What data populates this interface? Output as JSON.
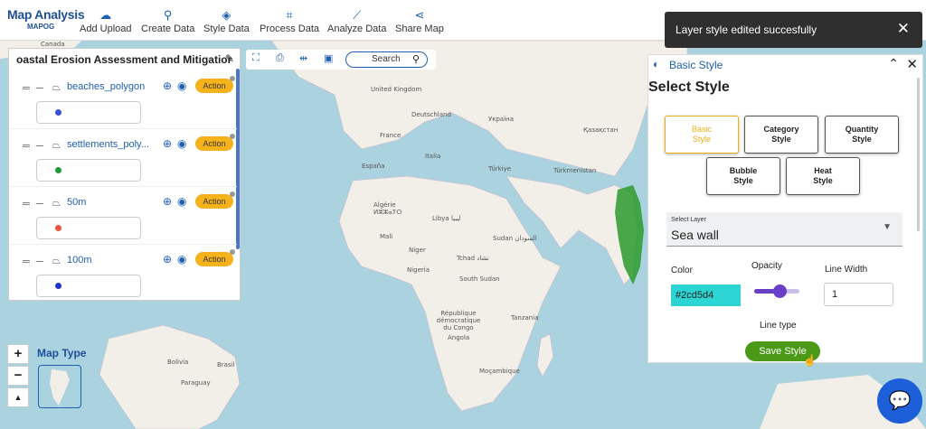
{
  "app": {
    "logo_line1": "Map Analysis",
    "logo_line2": "MAPOG"
  },
  "toolbar": [
    {
      "label": "Add Upload",
      "icon": "cloud-upload-icon",
      "glyph": "☁"
    },
    {
      "label": "Create Data",
      "icon": "map-pin-icon",
      "glyph": "⚲"
    },
    {
      "label": "Style Data",
      "icon": "paint-bucket-icon",
      "glyph": "◈"
    },
    {
      "label": "Process Data",
      "icon": "process-nodes-icon",
      "glyph": "⌗"
    },
    {
      "label": "Analyze Data",
      "icon": "analyze-icon",
      "glyph": "⟋"
    },
    {
      "label": "Share Map",
      "icon": "share-icon",
      "glyph": "⋖"
    }
  ],
  "layer_panel": {
    "title": "oastal Erosion Assessment and Mitigation",
    "action_label": "Action",
    "layers": [
      {
        "name": "beaches_polygon",
        "color": "#3a4fd8"
      },
      {
        "name": "settlements_poly...",
        "color": "#1e9a3a"
      },
      {
        "name": "50m",
        "color": "#e8553a"
      },
      {
        "name": "100m",
        "color": "#2233cc"
      }
    ]
  },
  "map_tools": {
    "search_label": "Search"
  },
  "toast": {
    "message": "Layer style edited succesfully"
  },
  "style_panel": {
    "header": "Basic Style",
    "title": "Select Style",
    "buttons": [
      {
        "line1": "Basic",
        "line2": "Style",
        "active": true
      },
      {
        "line1": "Category",
        "line2": "Style",
        "active": false
      },
      {
        "line1": "Quantity",
        "line2": "Style",
        "active": false
      },
      {
        "line1": "Bubble",
        "line2": "Style",
        "active": false
      },
      {
        "line1": "Heat",
        "line2": "Style",
        "active": false
      }
    ],
    "select_layer_label": "Select Layer",
    "select_layer_value": "Sea wall",
    "color_label": "Color",
    "color_value": "#2cd5d4",
    "opacity_label": "Opacity",
    "opacity_value": 0.55,
    "line_width_label": "Line Width",
    "line_width_value": "1",
    "line_type_label": "Line type",
    "save_label": "Save Style"
  },
  "map_controls": {
    "zoom_in": "+",
    "zoom_out": "−",
    "north": "▲",
    "map_type_label": "Map Type"
  },
  "map_labels": [
    "Canada",
    "United Kingdom",
    "Deutschland",
    "France",
    "España",
    "Italia",
    "Türkiye",
    "Україна",
    "Қазақстан",
    "Türkmenistan",
    "Algérie ⵍⵣⵣⴰⵢⵔ",
    "Libya ليبيا",
    "Mali",
    "Niger",
    "Tchad تشاد",
    "Nigeria",
    "Sudan السودان",
    "South Sudan",
    "République démocratique du Congo",
    "Tanzania",
    "Angola",
    "Moçambique",
    "Bolivia",
    "Paraguay",
    "Brasil"
  ]
}
